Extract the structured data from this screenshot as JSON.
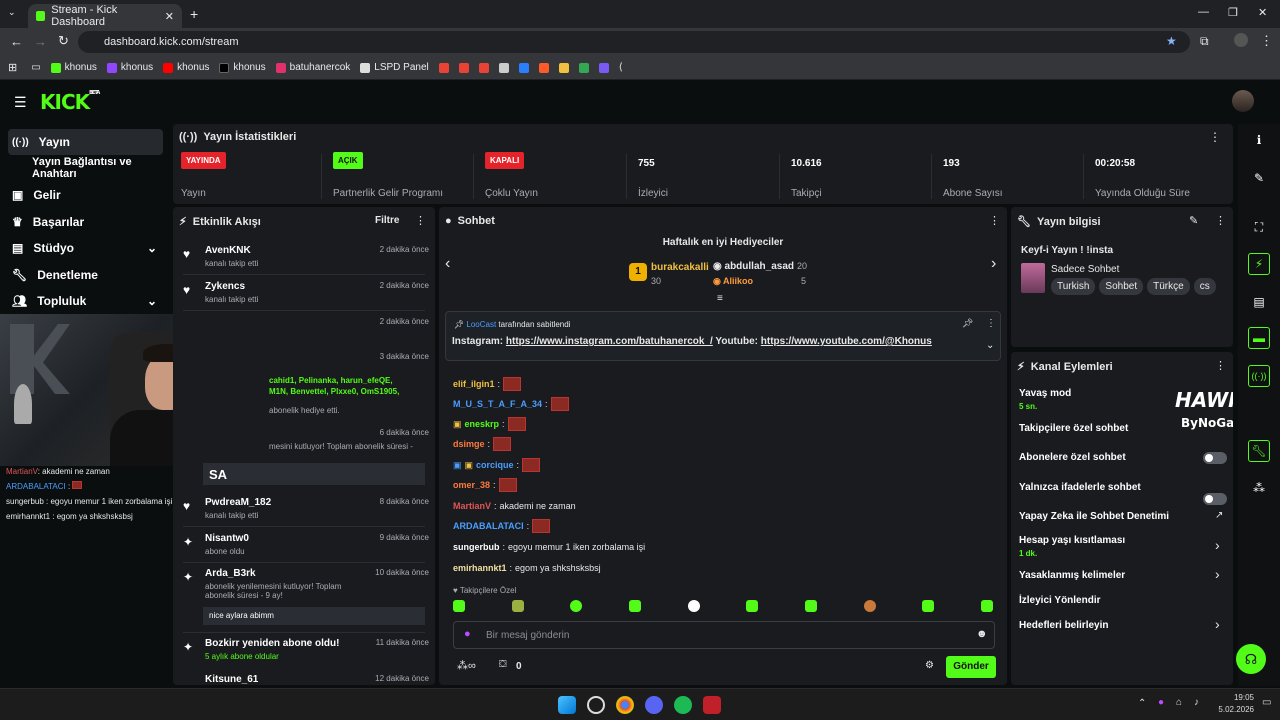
{
  "browser": {
    "tab_title": "Stream - Kick Dashboard",
    "url": "dashboard.kick.com/stream",
    "bookmarks": [
      "khonus",
      "khonus",
      "khonus",
      "khonus",
      "batuhanercok",
      "LSPD Panel"
    ]
  },
  "brand": {
    "logo": "KICK",
    "beta": "BETA",
    "accent": "#53fc18"
  },
  "sidebar": {
    "items": [
      {
        "label": "Yayın",
        "icon": "broadcast-icon"
      },
      {
        "label": "Yayın Bağlantısı ve Anahtarı",
        "icon": ""
      },
      {
        "label": "Gelir",
        "icon": "money-icon"
      },
      {
        "label": "Başarılar",
        "icon": "trophy-icon"
      },
      {
        "label": "Stüdyo",
        "icon": "studio-icon"
      },
      {
        "label": "Denetleme",
        "icon": "wrench-icon"
      },
      {
        "label": "Topluluk",
        "icon": "users-icon"
      }
    ]
  },
  "overlay_chat": [
    {
      "user": "MartianV",
      "color": "#e05555",
      "msg": "akademi ne zaman"
    },
    {
      "user": "ARDABALATACI",
      "color": "#4a9eff",
      "msg": ""
    },
    {
      "user": "sungerbub",
      "color": "#ffffff",
      "msg": "egoyu memur 1 iken zorbalama işi"
    },
    {
      "user": "emirhannkt1",
      "color": "#ffffff",
      "msg": "egom ya shkshsksbsj"
    }
  ],
  "stats": {
    "title": "Yayın İstatistikleri",
    "items": [
      {
        "badge": "YAYINDA",
        "badge_color": "#e5232a",
        "label": "Yayın"
      },
      {
        "badge": "AÇIK",
        "badge_color": "#53fc18",
        "label": "Partnerlik Gelir Programı"
      },
      {
        "badge": "KAPALI",
        "badge_color": "#e5232a",
        "label": "Çoklu Yayın"
      },
      {
        "value": "755",
        "label": "İzleyici"
      },
      {
        "value": "10.616",
        "label": "Takipçi"
      },
      {
        "value": "193",
        "label": "Abone Sayısı"
      },
      {
        "value": "00:20:58",
        "label": "Yayında Olduğu Süre"
      }
    ]
  },
  "activity": {
    "title": "Etkinlik Akışı",
    "filter": "Filtre",
    "events": [
      {
        "name": "AvenKNK",
        "text": "kanalı takip etti",
        "time": "2 dakika önce",
        "icon": "heart-icon"
      },
      {
        "name": "Zykencs",
        "text": "kanalı takip etti",
        "time": "2 dakika önce",
        "icon": "heart-icon"
      },
      {
        "name": "",
        "text": "",
        "time": "2 dakika önce",
        "icon": ""
      },
      {
        "name": "",
        "text": "",
        "time": "3 dakika önce",
        "icon": ""
      },
      {
        "name": "",
        "text": "",
        "time": "6 dakika önce",
        "icon": ""
      },
      {
        "name": "PwdreaM_182",
        "text": "kanalı takip etti",
        "time": "8 dakika önce",
        "icon": "heart-icon"
      },
      {
        "name": "Nisantw0",
        "text": "abone oldu",
        "time": "9 dakika önce",
        "icon": "sparkle-icon"
      },
      {
        "name": "Arda_B3rk",
        "text": "abonelik yenilemesini kutluyor! Toplam abonelik süresi - 9 ay!",
        "time": "10 dakika önce",
        "icon": "sparkle-icon"
      },
      {
        "name": "Bozkirr yeniden abone oldu!",
        "text": "5 aylık abone oldular",
        "time": "11 dakika önce",
        "icon": "sparkle-icon"
      },
      {
        "name": "Kitsune_61",
        "text": "",
        "time": "12 dakika önce",
        "icon": ""
      }
    ],
    "partial_names": "cahid1, Pelinanka, harun_efeQE,",
    "partial_names2": "M1N, Benvettel, Plxxe0, OmS1905,",
    "gift_text": "abonelik hediye etti.",
    "renew_text": "mesini kutluyor! Toplam abonelik süresi -",
    "sa_text": "SA",
    "arda_quote": "nice aylara abimm"
  },
  "chat": {
    "title": "Sohbet",
    "gifters_title": "Haftalık en iyi Hediyeciler",
    "gifters": [
      {
        "rank": "1",
        "name": "burakcakalli",
        "count": "30"
      },
      {
        "rank": "",
        "name": "abdullah_asad",
        "count": "20"
      },
      {
        "rank": "",
        "name": "Aliikoo",
        "count": "5"
      }
    ],
    "pinned_by": "LooCast",
    "pinned_label": "tarafından sabitlendi",
    "pinned_msg_prefix": "Instagram:",
    "pinned_link1": "https://www.instagram.com/batuhanercok_/",
    "pinned_mid": "Youtube:",
    "pinned_link2": "https://www.youtube.com/@Khonus",
    "messages": [
      {
        "user": "elif_ilgin1",
        "color": "#f0c040",
        "msg": "",
        "emote": true
      },
      {
        "user": "M_U_S_T_A_F_A_34",
        "color": "#4a9eff",
        "msg": "",
        "emote": true
      },
      {
        "user": "eneskrp",
        "color": "#53fc18",
        "msg": "",
        "emote": true
      },
      {
        "user": "dsimge",
        "color": "#ff7a3c",
        "msg": "",
        "emote": true
      },
      {
        "user": "corcique",
        "color": "#4a9eff",
        "msg": "",
        "emote": true
      },
      {
        "user": "omer_38",
        "color": "#ff7a3c",
        "msg": "",
        "emote": true
      },
      {
        "user": "MartianV",
        "color": "#e05555",
        "msg": "akademi ne zaman",
        "emote": false
      },
      {
        "user": "ARDABALATACI",
        "color": "#4a9eff",
        "msg": "",
        "emote": true
      },
      {
        "user": "sungerbub",
        "color": "#ffffff",
        "msg": "egoyu memur 1 iken zorbalama işi",
        "emote": false
      },
      {
        "user": "emirhannkt1",
        "color": "#f0e0a0",
        "msg": "egom ya shkshsksbsj",
        "emote": false
      }
    ],
    "followers_only": "Takipçilere Özel",
    "input_placeholder": "Bir mesaj gönderin",
    "points": "0",
    "send_label": "Gönder"
  },
  "stream_info": {
    "title": "Yayın bilgisi",
    "stream_title": "Keyf-i Yayın ! !insta",
    "category": "Sadece Sohbet",
    "tags": [
      "Turkish",
      "Sohbet",
      "Türkçe",
      "cs"
    ]
  },
  "channel_actions": {
    "title": "Kanal Eylemleri",
    "items": [
      {
        "label": "Yavaş mod",
        "sub": "5 sn."
      },
      {
        "label": "Takipçilere özel sohbet",
        "sub": ""
      },
      {
        "label": "Abonelere özel sohbet",
        "sub": ""
      },
      {
        "label": "Yalnızca ifadelerle sohbet",
        "sub": ""
      },
      {
        "label": "Yapay Zeka ile Sohbet Denetimi",
        "sub": ""
      },
      {
        "label": "Hesap yaşı kısıtlaması",
        "sub": "1 dk."
      },
      {
        "label": "Yasaklanmış kelimeler",
        "sub": ""
      },
      {
        "label": "İzleyici Yönlendir",
        "sub": ""
      },
      {
        "label": "Hedefleri belirleyin",
        "sub": ""
      }
    ],
    "hawk_text": "HAWK",
    "bynogame_text": "ByNoGame"
  },
  "taskbar": {
    "time": "19:05",
    "date": "5.02.2026"
  }
}
